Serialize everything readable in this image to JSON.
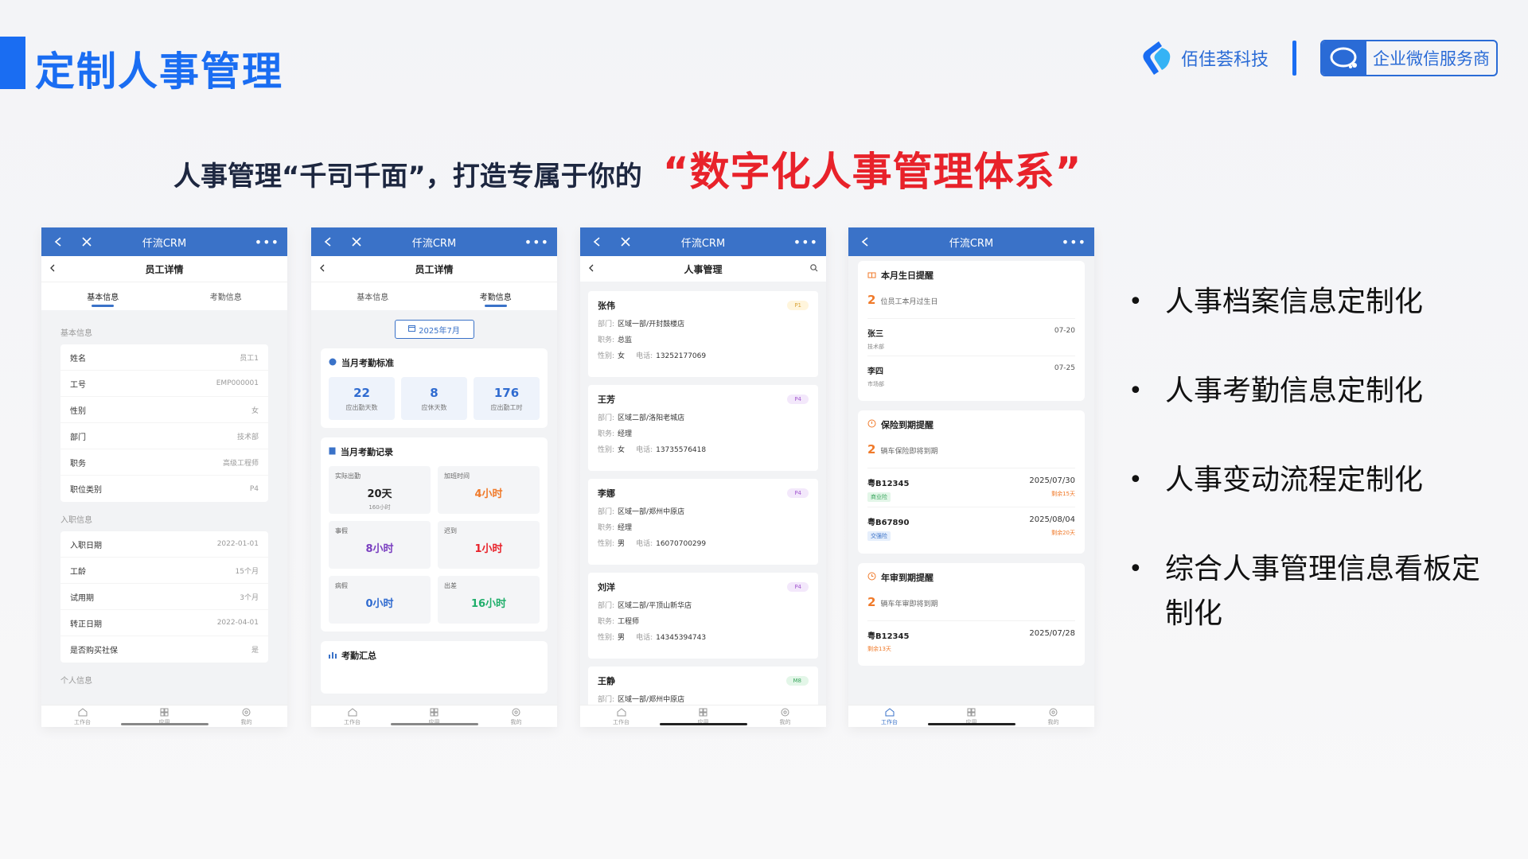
{
  "header": {
    "title": "定制人事管理",
    "brand_name": "佰佳荟科技",
    "partner_name": "企业微信服务商"
  },
  "slogan": {
    "main": "人事管理“千司千面”，打造专属于你的",
    "accent": "“数字化人事管理体系”"
  },
  "colors": {
    "accent": "#1a6df2",
    "red": "#e8222a",
    "app_bar": "#3a72c8"
  },
  "app": {
    "name": "仟流CRM",
    "more": "•••",
    "tabbar": [
      "工作台",
      "应用",
      "我的"
    ]
  },
  "phone1": {
    "subtitle": "员工详情",
    "tabs": [
      "基本信息",
      "考勤信息"
    ],
    "basic_label": "基本信息",
    "basic_rows": [
      {
        "k": "姓名",
        "v": "员工1"
      },
      {
        "k": "工号",
        "v": "EMP000001"
      },
      {
        "k": "性别",
        "v": "女"
      },
      {
        "k": "部门",
        "v": "技术部"
      },
      {
        "k": "职务",
        "v": "高级工程师"
      },
      {
        "k": "职位类别",
        "v": "P4"
      }
    ],
    "entry_label": "入职信息",
    "entry_rows": [
      {
        "k": "入职日期",
        "v": "2022-01-01"
      },
      {
        "k": "工龄",
        "v": "15个月"
      },
      {
        "k": "试用期",
        "v": "3个月"
      },
      {
        "k": "转正日期",
        "v": "2022-04-01"
      },
      {
        "k": "是否购买社保",
        "v": "是"
      }
    ],
    "personal_label": "个人信息"
  },
  "phone2": {
    "subtitle": "员工详情",
    "tabs": [
      "基本信息",
      "考勤信息"
    ],
    "month": "2025年7月",
    "standard_title": "当月考勤标准",
    "standard": [
      {
        "num": "22",
        "lbl": "应出勤天数"
      },
      {
        "num": "8",
        "lbl": "应休天数"
      },
      {
        "num": "176",
        "lbl": "应出勤工时"
      }
    ],
    "record_title": "当月考勤记录",
    "records": [
      {
        "label": "实际出勤",
        "value": "20天",
        "sub": "160小时",
        "color": "#222222"
      },
      {
        "label": "加班时间",
        "value": "4小时",
        "sub": "",
        "color": "#f07a2a"
      },
      {
        "label": "事假",
        "value": "8小时",
        "sub": "",
        "color": "#7a3fc0"
      },
      {
        "label": "迟到",
        "value": "1小时",
        "sub": "",
        "color": "#e8222a"
      },
      {
        "label": "病假",
        "value": "0小时",
        "sub": "",
        "color": "#2f6bd0"
      },
      {
        "label": "出差",
        "value": "16小时",
        "sub": "",
        "color": "#1fae6a"
      }
    ],
    "summary_title": "考勤汇总"
  },
  "phone3": {
    "subtitle": "人事管理",
    "labels": {
      "dept": "部门:",
      "role": "职务:",
      "gender": "性别:",
      "phone": "电话:"
    },
    "employees": [
      {
        "name": "张伟",
        "badge": "P1",
        "badge_bg": "#fff5dc",
        "badge_fg": "#d9a43a",
        "dept": "区域一部/开封鼓楼店",
        "role": "总监",
        "gender": "女",
        "phone": "13252177069"
      },
      {
        "name": "王芳",
        "badge": "P4",
        "badge_bg": "#f3e8fb",
        "badge_fg": "#a45ad0",
        "dept": "区域二部/洛阳老城店",
        "role": "经理",
        "gender": "女",
        "phone": "13735576418"
      },
      {
        "name": "李娜",
        "badge": "P4",
        "badge_bg": "#f3e8fb",
        "badge_fg": "#a45ad0",
        "dept": "区域一部/郑州中原店",
        "role": "经理",
        "gender": "男",
        "phone": "16070700299"
      },
      {
        "name": "刘洋",
        "badge": "P4",
        "badge_bg": "#f3e8fb",
        "badge_fg": "#a45ad0",
        "dept": "区域二部/平顶山新华店",
        "role": "工程师",
        "gender": "男",
        "phone": "14345394743"
      },
      {
        "name": "王静",
        "badge": "M8",
        "badge_bg": "#e3f6e8",
        "badge_fg": "#3aa65e",
        "dept": "区域一部/郑州中原店",
        "role": "",
        "gender": "",
        "phone": ""
      }
    ]
  },
  "phone4": {
    "birthday": {
      "title": "本月生日提醒",
      "count": "2",
      "count_text": "位员工本月过生日",
      "items": [
        {
          "name": "张三",
          "sub": "技术部",
          "date": "07-20"
        },
        {
          "name": "李四",
          "sub": "市场部",
          "date": "07-25"
        }
      ]
    },
    "insurance": {
      "title": "保险到期提醒",
      "count": "2",
      "count_text": "辆车保险即将到期",
      "items": [
        {
          "plate": "粤B12345",
          "tag": "商业险",
          "tag_bg": "#e3f6e8",
          "tag_fg": "#3aa65e",
          "date": "2025/07/30",
          "left": "剩余15天"
        },
        {
          "plate": "粤B67890",
          "tag": "交强险",
          "tag_bg": "#e6effc",
          "tag_fg": "#3a72c8",
          "date": "2025/08/04",
          "left": "剩余20天"
        }
      ]
    },
    "annual": {
      "title": "年审到期提醒",
      "count": "2",
      "count_text": "辆车年审即将到期",
      "items": [
        {
          "plate": "粤B12345",
          "date": "2025/07/28",
          "left": "剩余13天"
        }
      ]
    }
  },
  "bullets": [
    "人事档案信息定制化",
    "人事考勤信息定制化",
    "人事变动流程定制化",
    "综合人事管理信息看板定制化"
  ],
  "icons": [
    "back-arrow-icon",
    "close-icon",
    "search-icon",
    "calendar-icon",
    "home-icon",
    "apps-icon",
    "settings-icon",
    "gift-icon",
    "alert-icon",
    "clock-icon"
  ]
}
